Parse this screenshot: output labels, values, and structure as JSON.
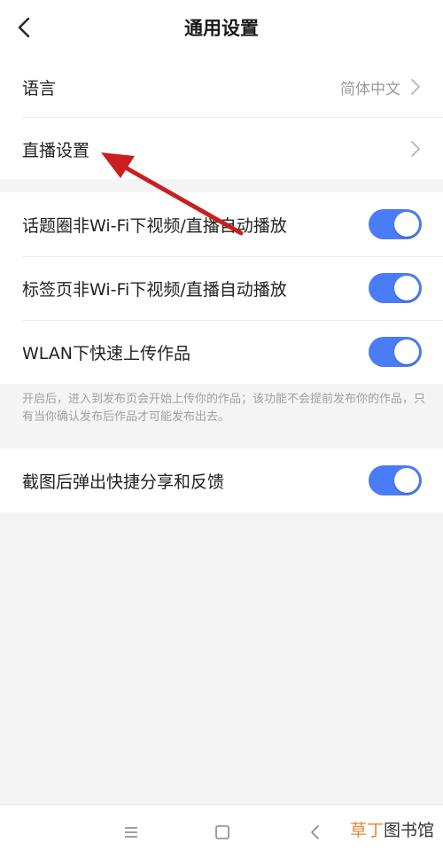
{
  "header": {
    "title": "通用设置",
    "back_icon": "chevron-left-icon"
  },
  "group1": {
    "language": {
      "label": "语言",
      "value": "简体中文"
    },
    "live": {
      "label": "直播设置"
    }
  },
  "group2": {
    "items": [
      {
        "label": "话题圈非Wi-Fi下视频/直播自动播放",
        "enabled": true
      },
      {
        "label": "标签页非Wi-Fi下视频/直播自动播放",
        "enabled": true
      },
      {
        "label": "WLAN下快速上传作品",
        "enabled": true
      }
    ],
    "note": "开启后，进入到发布页会开始上传你的作品；该功能不会提前发布你的作品，只有当你确认发布后作品才可能发布出去。"
  },
  "group3": {
    "items": [
      {
        "label": "截图后弹出快捷分享和反馈",
        "enabled": true
      }
    ]
  },
  "navbar": {
    "icons": [
      "menu-icon",
      "home-square-icon",
      "back-triangle-icon"
    ]
  },
  "watermark": {
    "accent": "草丁",
    "rest": "图书馆"
  },
  "colors": {
    "toggle_on": "#4a7cf7",
    "annotation_arrow": "#c8201e",
    "watermark_accent": "#e8873a"
  }
}
